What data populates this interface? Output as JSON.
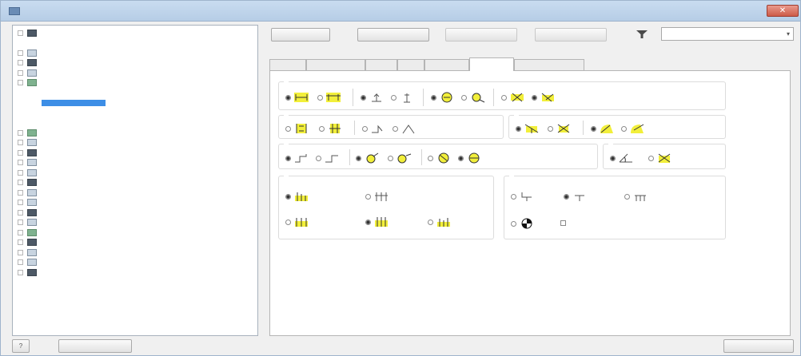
{
  "window": {
    "title": "",
    "close_glyph": "✕"
  },
  "tree": {
    "items": [
      {
        "label": "",
        "icon": "folder-icon",
        "level": 0,
        "expander": true,
        "selected": false
      },
      {
        "label": "",
        "icon": "",
        "level": 1,
        "expander": false,
        "selected": false
      },
      {
        "label": "",
        "icon": "balloon-icon",
        "level": 0,
        "expander": true,
        "selected": false
      },
      {
        "label": "",
        "icon": "center-mark-icon",
        "level": 0,
        "expander": true,
        "selected": false
      },
      {
        "label": "",
        "icon": "datum-target-icon",
        "level": 0,
        "expander": true,
        "selected": false
      },
      {
        "label": "",
        "icon": "dimension-icon",
        "level": 0,
        "expander": true,
        "selected": false
      },
      {
        "label": "",
        "icon": "",
        "level": 1,
        "expander": false,
        "selected": false
      },
      {
        "label": "",
        "icon": "",
        "level": 1,
        "expander": false,
        "selected": true
      },
      {
        "label": "",
        "icon": "",
        "level": 1,
        "expander": false,
        "selected": false
      },
      {
        "label": "",
        "icon": "",
        "level": 1,
        "expander": false,
        "selected": false
      },
      {
        "label": "",
        "icon": "feature-control-frame-icon",
        "level": 0,
        "expander": true,
        "selected": false
      },
      {
        "label": "",
        "icon": "hatch-icon",
        "level": 0,
        "expander": true,
        "selected": false
      },
      {
        "label": "",
        "icon": "hole-table-icon",
        "level": 0,
        "expander": true,
        "selected": false
      },
      {
        "label": "",
        "icon": "id-icon",
        "level": 0,
        "expander": true,
        "selected": false
      },
      {
        "label": "",
        "icon": "leader-icon",
        "level": 0,
        "expander": true,
        "selected": false
      },
      {
        "label": "",
        "icon": "leader-icon",
        "level": 0,
        "expander": true,
        "selected": false
      },
      {
        "label": "",
        "icon": "object-defaults-icon",
        "level": 0,
        "expander": true,
        "selected": false
      },
      {
        "label": "",
        "icon": "parts-list-icon",
        "level": 0,
        "expander": true,
        "selected": false
      },
      {
        "label": "",
        "icon": "revision-table-icon",
        "level": 0,
        "expander": true,
        "selected": false
      },
      {
        "label": "",
        "icon": "surface-texture-icon",
        "level": 0,
        "expander": true,
        "selected": false
      },
      {
        "label": "",
        "icon": "table-icon",
        "level": 0,
        "expander": true,
        "selected": false
      },
      {
        "label": "",
        "icon": "text-icon",
        "level": 0,
        "expander": true,
        "selected": false
      },
      {
        "label": "",
        "icon": "view-annotation-icon",
        "level": 0,
        "expander": true,
        "selected": false
      },
      {
        "label": "",
        "icon": "weld-symbol-icon",
        "level": 0,
        "expander": true,
        "selected": false
      },
      {
        "label": "",
        "icon": "weld-bead-icon",
        "level": 0,
        "expander": true,
        "selected": false
      }
    ]
  },
  "toolbar": {
    "back_label": "",
    "new_label": "",
    "save_label": "",
    "reset_label": "",
    "filter_value": "",
    "combo_arrow": "▾"
  },
  "style_name_label": "",
  "tabs": [
    {
      "label": "",
      "active": false
    },
    {
      "label": "",
      "active": false
    },
    {
      "label": "",
      "active": false
    },
    {
      "label": "",
      "active": false
    },
    {
      "label": "",
      "active": false
    },
    {
      "label": "",
      "active": true
    },
    {
      "label": "",
      "active": false
    }
  ],
  "groups": {
    "arrowhead": {
      "title": ""
    },
    "hole_dimension": {
      "title": ""
    },
    "radius_dimensions": {
      "title": ""
    },
    "diameter_dimensions": {
      "title": ""
    },
    "angular_dimensions": {
      "title": ""
    },
    "ordinate_location": {
      "title": "",
      "stagger_label": "",
      "alignment_label": ""
    },
    "ordinate_origin": {
      "title": "",
      "checkbox_label": ""
    }
  },
  "bottom": {
    "help_glyph": "?",
    "import_label": "",
    "done_label": ""
  },
  "colors": {
    "accent": "#3d8ee6",
    "highlight_yellow": "#f2ef3a"
  }
}
